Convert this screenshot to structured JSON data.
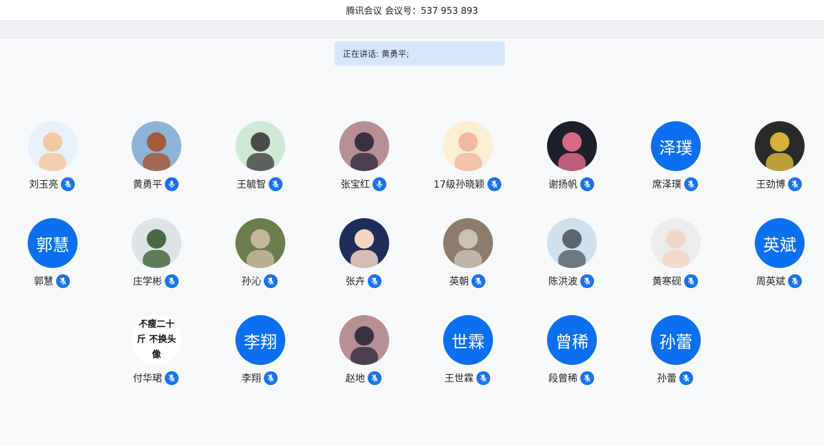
{
  "window": {
    "title": "腾讯会议 会议号：537 953 893"
  },
  "banner": {
    "speaking": "正在讲话: 黄勇平;"
  },
  "colors": {
    "accent": "#0b6ff0",
    "mic": "#1a73e8",
    "banner_bg": "#d6e7fb"
  },
  "participants": [
    {
      "name": "刘玉亮",
      "avatar_type": "image",
      "avatar_desc": "cartoon-boy-avatar",
      "mic": "muted-mic-icon"
    },
    {
      "name": "黄勇平",
      "avatar_type": "image",
      "avatar_desc": "landscape-photo-avatar",
      "mic": "mic-active-icon"
    },
    {
      "name": "王毓智",
      "avatar_type": "image",
      "avatar_desc": "cartoon-character-avatar",
      "mic": "muted-mic-icon"
    },
    {
      "name": "张宝红",
      "avatar_type": "image",
      "avatar_desc": "person-photo-avatar",
      "mic": "mic-active-icon"
    },
    {
      "name": "17级孙晓颖",
      "avatar_type": "image",
      "avatar_desc": "cartoon-girl-avatar",
      "mic": "muted-mic-icon"
    },
    {
      "name": "谢扬帆",
      "avatar_type": "image",
      "avatar_desc": "dark-photo-avatar",
      "mic": "muted-mic-icon"
    },
    {
      "name": "席泽璞",
      "avatar_type": "text",
      "avatar_text": "泽璞",
      "mic": "muted-mic-icon"
    },
    {
      "name": "王劲博",
      "avatar_type": "image",
      "avatar_desc": "camera-lens-avatar",
      "mic": "muted-mic-icon"
    },
    {
      "name": "郭慧",
      "avatar_type": "text",
      "avatar_text": "郭慧",
      "mic": "muted-mic-icon"
    },
    {
      "name": "庄学彬",
      "avatar_type": "image",
      "avatar_desc": "mountain-photo-avatar",
      "mic": "muted-mic-icon"
    },
    {
      "name": "孙沁",
      "avatar_type": "image",
      "avatar_desc": "outdoor-photo-avatar",
      "mic": "muted-mic-icon"
    },
    {
      "name": "张卉",
      "avatar_type": "image",
      "avatar_desc": "cartoon-2019-avatar",
      "mic": "muted-mic-icon"
    },
    {
      "name": "英朝",
      "avatar_type": "image",
      "avatar_desc": "toy-photo-avatar",
      "mic": "muted-mic-icon"
    },
    {
      "name": "陈洪波",
      "avatar_type": "image",
      "avatar_desc": "airplane-photo-avatar",
      "mic": "muted-mic-icon"
    },
    {
      "name": "黄寒砚",
      "avatar_type": "image",
      "avatar_desc": "child-photo-avatar",
      "mic": "muted-mic-icon"
    },
    {
      "name": "周英斌",
      "avatar_type": "text",
      "avatar_text": "英斌",
      "mic": "muted-mic-icon"
    },
    {
      "name": "付华珺",
      "avatar_type": "image",
      "avatar_desc": "text-meme-avatar",
      "avatar_caption": "不瘦二十斤 不换头像",
      "mic": "muted-mic-icon"
    },
    {
      "name": "李翔",
      "avatar_type": "text",
      "avatar_text": "李翔",
      "mic": "muted-mic-icon"
    },
    {
      "name": "赵地",
      "avatar_type": "image",
      "avatar_desc": "person-photo-avatar",
      "mic": "muted-mic-icon"
    },
    {
      "name": "王世霖",
      "avatar_type": "text",
      "avatar_text": "世霖",
      "mic": "muted-mic-icon"
    },
    {
      "name": "段曾稀",
      "avatar_type": "text",
      "avatar_text": "曾稀",
      "mic": "muted-mic-icon"
    },
    {
      "name": "孙蕾",
      "avatar_type": "text",
      "avatar_text": "孙蕾",
      "mic": "muted-mic-icon"
    }
  ]
}
